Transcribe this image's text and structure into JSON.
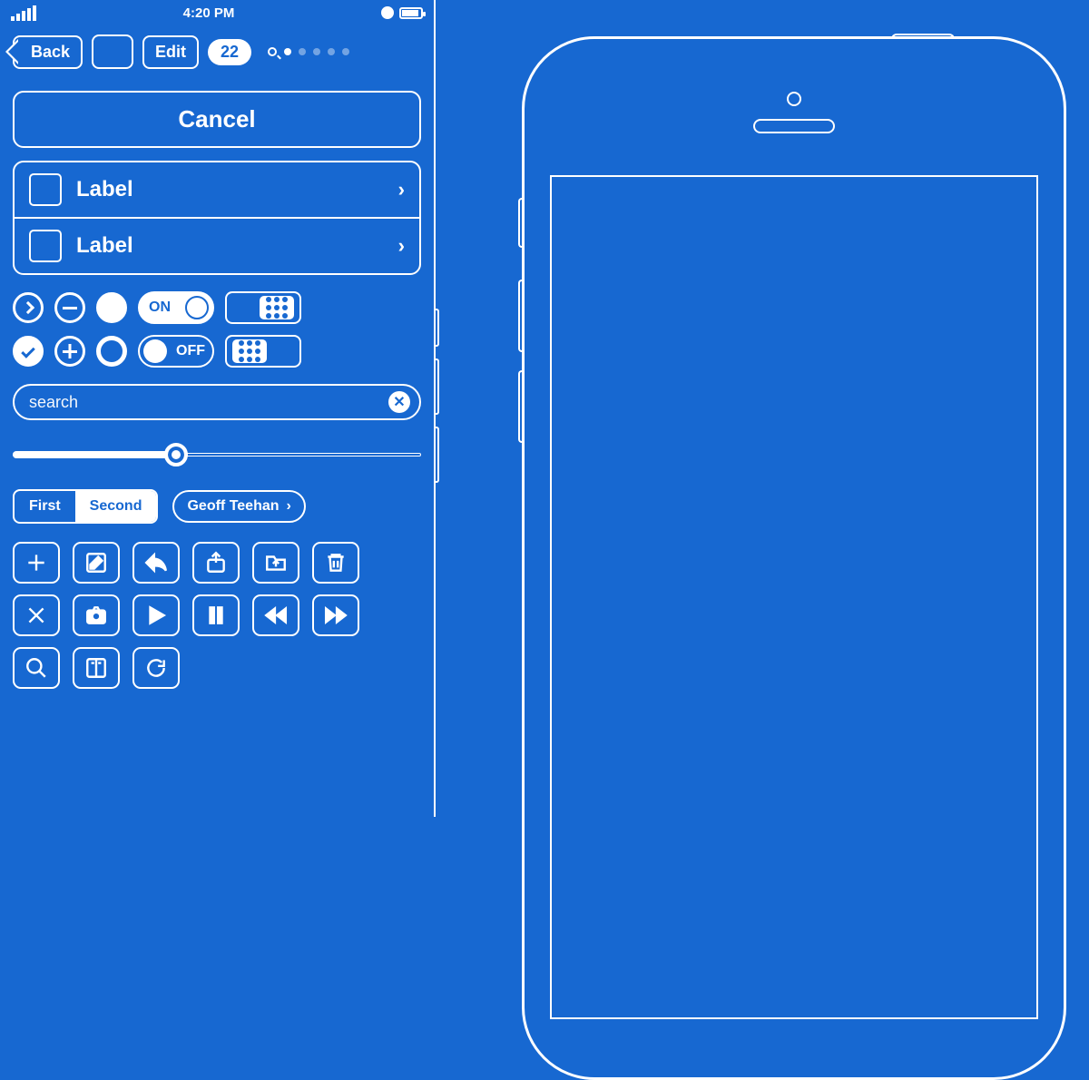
{
  "statusbar": {
    "time": "4:20 PM"
  },
  "nav": {
    "back": "Back",
    "edit": "Edit",
    "badge": "22"
  },
  "cancel": "Cancel",
  "list": {
    "row1": "Label",
    "row2": "Label"
  },
  "switches": {
    "on": "ON",
    "off": "OFF"
  },
  "search": {
    "placeholder": "search"
  },
  "slider": {
    "value": 40
  },
  "segmented": {
    "first": "First",
    "second": "Second",
    "selected": "Second"
  },
  "chip": {
    "label": "Geoff Teehan"
  }
}
